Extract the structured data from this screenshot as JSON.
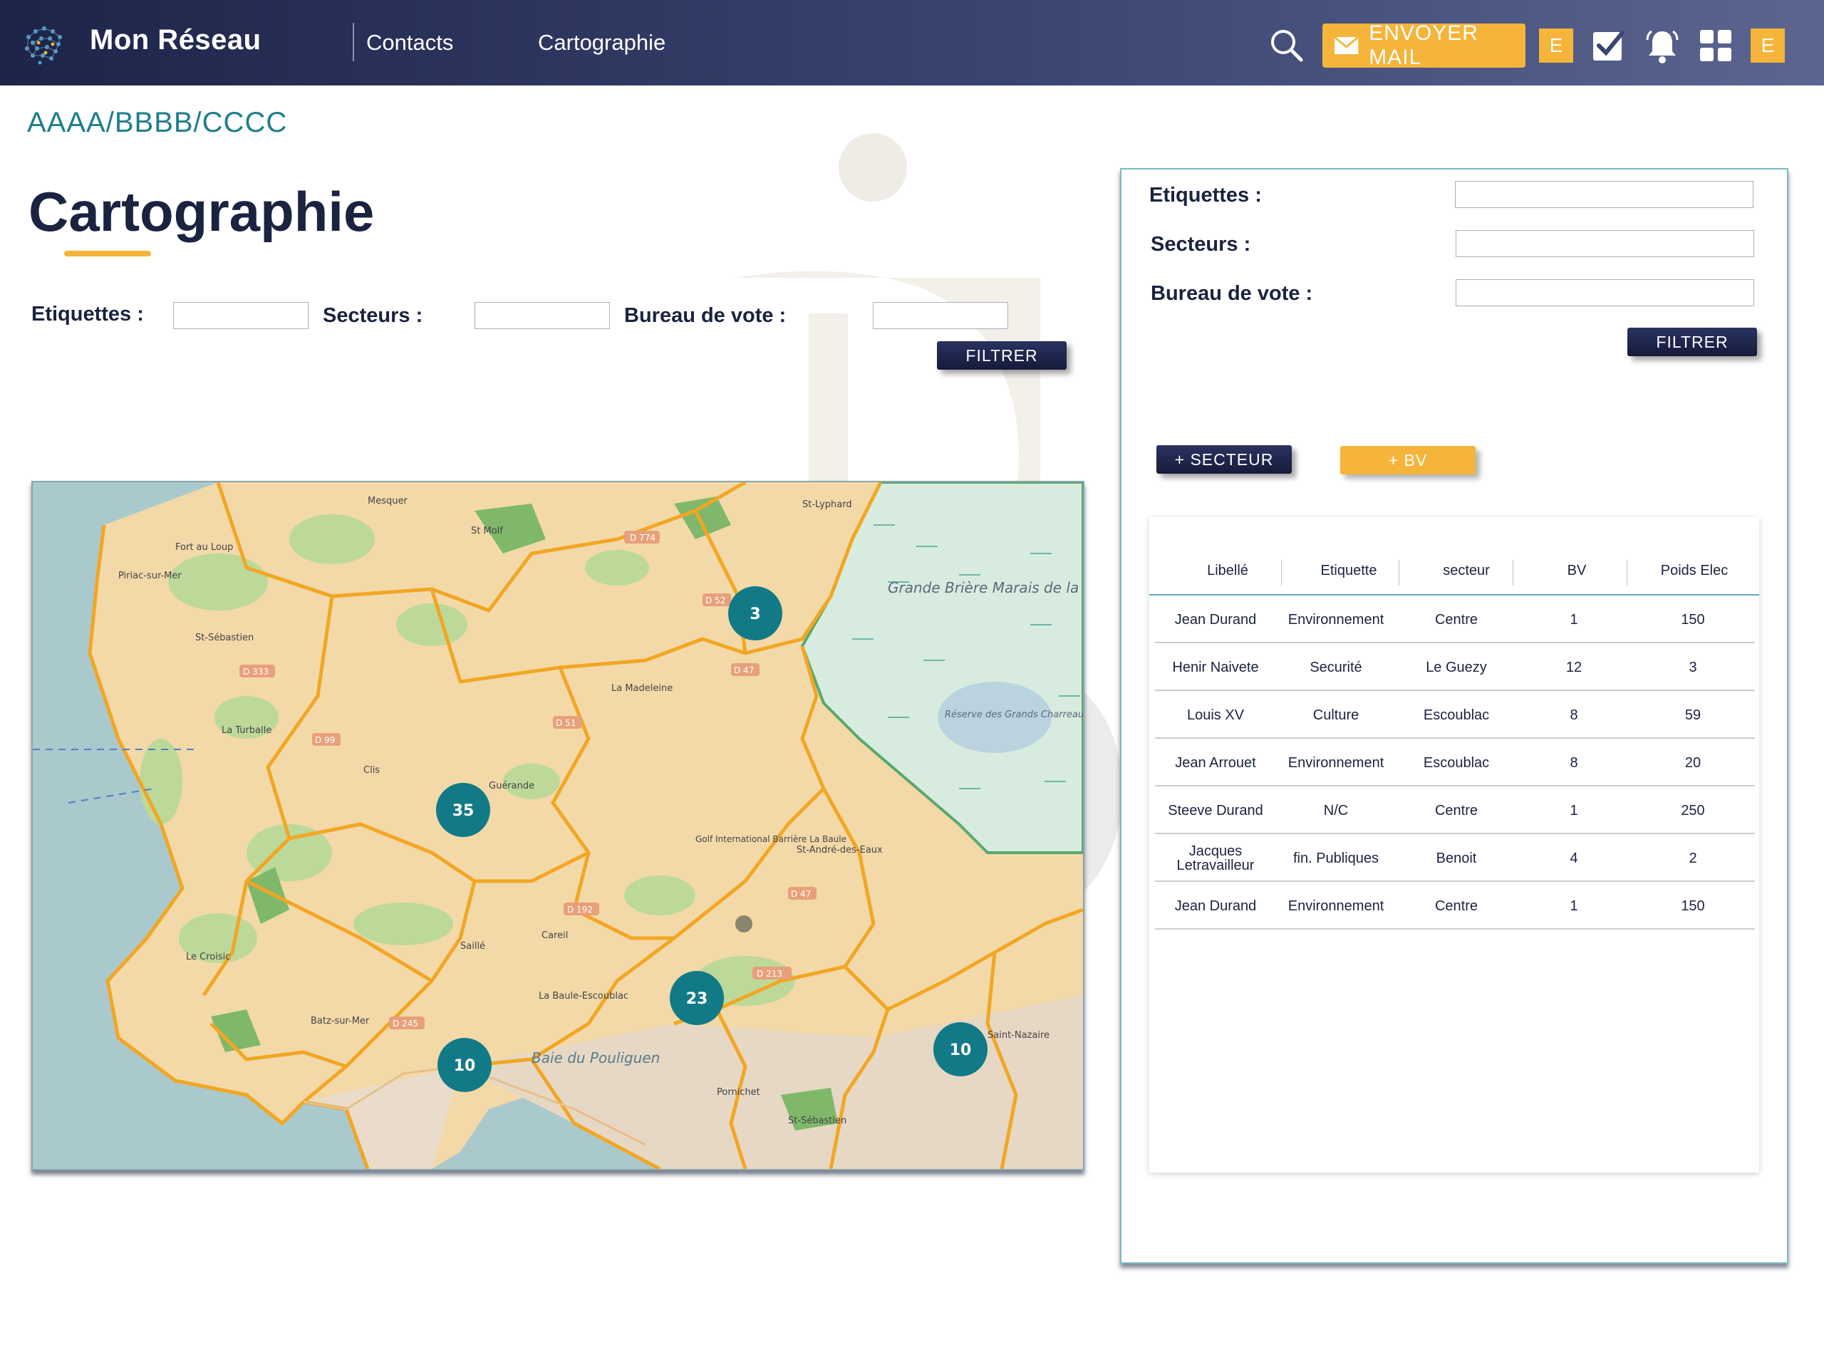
{
  "header": {
    "app_title": "Mon Réseau",
    "nav": {
      "contacts": "Contacts",
      "cartographie": "Cartographie"
    },
    "mail_button": "ENVOYER  MAIL",
    "badge_left": "E",
    "badge_right": "E"
  },
  "breadcrumb": "AAAA/BBBB/CCCC",
  "page_title": "Cartographie",
  "filters": {
    "etiquettes_label": "Etiquettes :",
    "secteurs_label": "Secteurs :",
    "bureau_label": "Bureau de vote :",
    "etiquettes_value": "",
    "secteurs_value": "",
    "bureau_value": "",
    "filter_button": "FILTRER"
  },
  "map": {
    "clusters": [
      "3",
      "35",
      "23",
      "10",
      "10"
    ],
    "place_labels": [
      "Mesquer",
      "St-Lyphard",
      "St Molf",
      "Piriac-sur-Mer",
      "Fort au Loup",
      "La Turballe",
      "St-Sébastien",
      "La Madeleine",
      "Clis",
      "Guérande",
      "Grande Brière Marais de la Grande Brière",
      "Réserve des Grands Charreaux",
      "Saillé",
      "Careil",
      "La Baule-Escoublac",
      "Baie du Pouliguen",
      "Batz-sur-Mer",
      "Le Croisic",
      "Pornichet",
      "St-André-des-Eaux",
      "Golf International Barrière La Baule",
      "St-Sébastien",
      "Saint-Nazaire"
    ],
    "roads": [
      "D 774",
      "D 52",
      "D 47",
      "D 51",
      "D 99",
      "D 333",
      "D 192",
      "D 213",
      "D 245",
      "D 47"
    ]
  },
  "panel": {
    "etiquettes_label": "Etiquettes :",
    "secteurs_label": "Secteurs :",
    "bureau_label": "Bureau de vote :",
    "etiquettes_value": "",
    "secteurs_value": "",
    "bureau_value": "",
    "filter_button": "FILTRER",
    "add_secteur": "+ SECTEUR",
    "add_bv": "+ BV"
  },
  "table": {
    "columns": [
      "Libellé",
      "Etiquette",
      "secteur",
      "BV",
      "Poids Elec"
    ],
    "rows": [
      [
        "Jean Durand",
        "Environnement",
        "Centre",
        "1",
        "150"
      ],
      [
        "Henir Naivete",
        "Securité",
        "Le Guezy",
        "12",
        "3"
      ],
      [
        "Louis XV",
        "Culture",
        "Escoublac",
        "8",
        "59"
      ],
      [
        "Jean Arrouet",
        "Environnement",
        "Escoublac",
        "8",
        "20"
      ],
      [
        "Steeve Durand",
        "N/C",
        "Centre",
        "1",
        "250"
      ],
      [
        "Jacques Letravailleur",
        "fin. Publiques",
        "Benoit",
        "4",
        "2"
      ],
      [
        "Jean Durand",
        "Environnement",
        "Centre",
        "1",
        "150"
      ]
    ]
  },
  "colors": {
    "accent": "#f5b43a",
    "header_dark": "#1d2448",
    "teal": "#1e7e8c",
    "cluster": "#127a86"
  }
}
